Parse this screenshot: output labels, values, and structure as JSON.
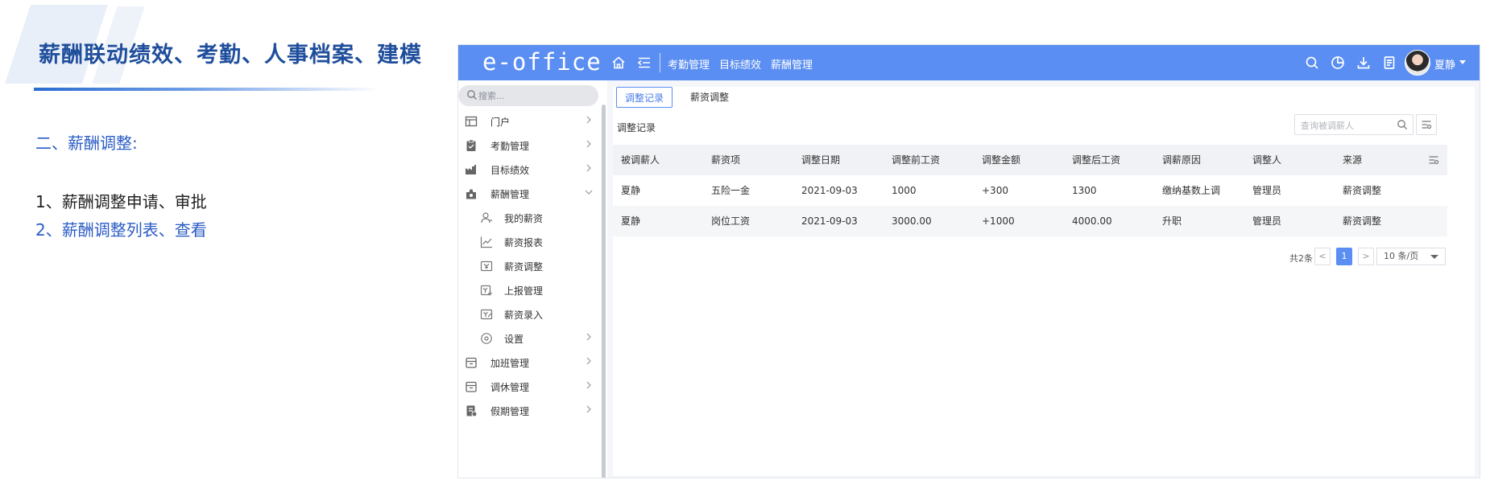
{
  "slide": {
    "title": "薪酬联动绩效、考勤、人事档案、建模",
    "section": "二、薪酬调整:",
    "bullets": [
      "1、薪酬调整申请、审批",
      "2、薪酬调整列表、查看"
    ]
  },
  "app": {
    "logo": "e-office",
    "top_nav": [
      "考勤管理",
      "目标绩效",
      "薪酬管理"
    ],
    "user": "夏静",
    "search_placeholder": "搜索...",
    "sidebar": [
      {
        "label": "门户",
        "icon": "portal-icon",
        "expandable": true
      },
      {
        "label": "考勤管理",
        "icon": "clipboard-icon",
        "expandable": true
      },
      {
        "label": "目标绩效",
        "icon": "factory-icon",
        "expandable": true
      },
      {
        "label": "薪酬管理",
        "icon": "money-bag-icon",
        "expandable": true,
        "expanded": true
      },
      {
        "label": "我的薪资",
        "icon": "user-icon",
        "sub": true
      },
      {
        "label": "薪资报表",
        "icon": "line-chart-icon",
        "sub": true
      },
      {
        "label": "薪资调整",
        "icon": "adjust-icon",
        "sub": true
      },
      {
        "label": "上报管理",
        "icon": "report-icon",
        "sub": true
      },
      {
        "label": "薪资录入",
        "icon": "entry-icon",
        "sub": true
      },
      {
        "label": "设置",
        "icon": "settings-icon",
        "sub": true,
        "expandable": true
      },
      {
        "label": "加班管理",
        "icon": "calendar-icon",
        "expandable": true
      },
      {
        "label": "调休管理",
        "icon": "calendar-icon",
        "expandable": true
      },
      {
        "label": "假期管理",
        "icon": "leave-icon",
        "expandable": true
      }
    ],
    "tabs": {
      "active": "调整记录",
      "inactive": "薪资调整"
    },
    "section_title": "调整记录",
    "query_placeholder": "查询被调薪人",
    "table": {
      "headers": [
        "被调薪人",
        "薪资项",
        "调整日期",
        "调整前工资",
        "调整金额",
        "调整后工资",
        "调薪原因",
        "调整人",
        "来源"
      ],
      "rows": [
        [
          "夏静",
          "五险一金",
          "2021-09-03",
          "1000",
          "+300",
          "1300",
          "缴纳基数上调",
          "管理员",
          "薪资调整"
        ],
        [
          "夏静",
          "岗位工资",
          "2021-09-03",
          "3000.00",
          "+1000",
          "4000.00",
          "升职",
          "管理员",
          "薪资调整"
        ]
      ]
    },
    "pagination": {
      "total": "共2条",
      "prev": "<",
      "current": "1",
      "next": ">",
      "page_size": "10 条/页"
    }
  }
}
